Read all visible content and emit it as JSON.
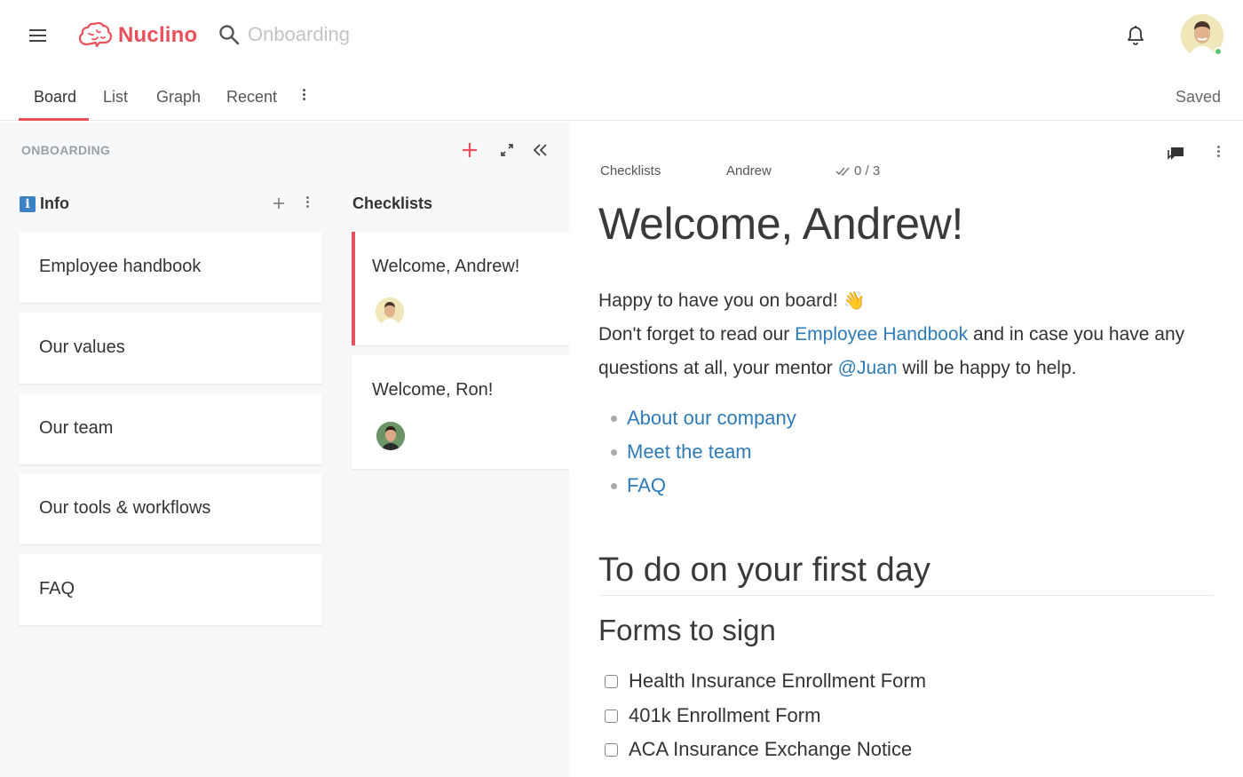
{
  "app": {
    "name": "Nuclino",
    "brand_color": "#e8505b"
  },
  "search": {
    "placeholder": "Onboarding",
    "value": ""
  },
  "tabs": [
    {
      "label": "Board",
      "active": true
    },
    {
      "label": "List"
    },
    {
      "label": "Graph"
    },
    {
      "label": "Recent"
    }
  ],
  "status": {
    "saved": "Saved"
  },
  "board": {
    "title": "ONBOARDING",
    "columns": [
      {
        "title": "Info",
        "badge": "i",
        "cards": [
          {
            "title": "Employee handbook"
          },
          {
            "title": "Our values"
          },
          {
            "title": "Our team"
          },
          {
            "title": "Our tools & workflows"
          },
          {
            "title": "FAQ"
          }
        ]
      },
      {
        "title": "Checklists",
        "cards": [
          {
            "title": "Welcome, Andrew!",
            "selected": true
          },
          {
            "title": "Welcome, Ron!"
          }
        ]
      }
    ]
  },
  "doc": {
    "meta": {
      "collection": "Checklists",
      "assignee": "Andrew",
      "progress": "0 / 3"
    },
    "title": "Welcome, Andrew!",
    "intro": "Happy to have you on board!",
    "emoji": "👋",
    "p2_before": "Don't forget to read our",
    "p2_link": "Employee Handbook",
    "p2_middle": "and in case you have any questions at all, your mentor",
    "p2_mention": "@Juan",
    "p2_after": "will be happy to help.",
    "links": [
      {
        "label": "About our company"
      },
      {
        "label": "Meet the team"
      },
      {
        "label": "FAQ"
      }
    ],
    "h2": "To do on your first day",
    "h3": "Forms to sign",
    "todos": [
      {
        "label": "Health Insurance Enrollment Form",
        "checked": false
      },
      {
        "label": "401k Enrollment Form",
        "checked": false
      },
      {
        "label": "ACA Insurance Exchange Notice",
        "checked": false
      }
    ]
  }
}
